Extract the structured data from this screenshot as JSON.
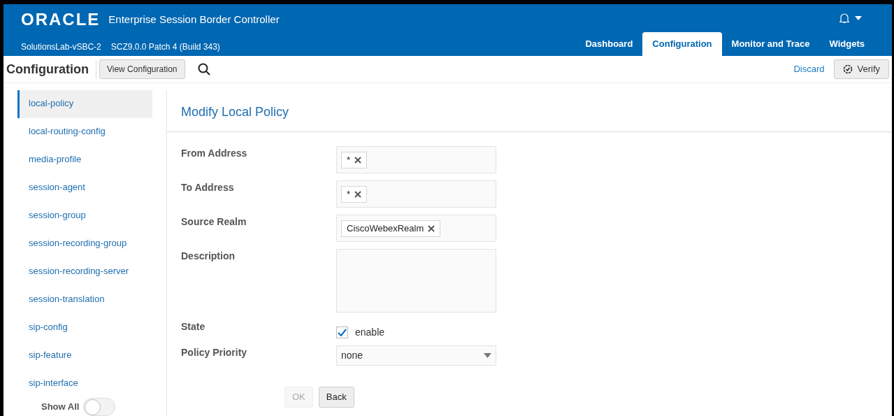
{
  "header": {
    "logo": "ORACLE",
    "product": "Enterprise Session Border Controller",
    "device": "SolutionsLab-vSBC-2",
    "version": "SCZ9.0.0 Patch 4 (Build 343)"
  },
  "tabs": [
    {
      "label": "Dashboard",
      "selected": false
    },
    {
      "label": "Configuration",
      "selected": true
    },
    {
      "label": "Monitor and Trace",
      "selected": false
    },
    {
      "label": "Widgets",
      "selected": false
    }
  ],
  "toolbar": {
    "title": "Configuration",
    "view_button": "View Configuration",
    "discard": "Discard",
    "verify": "Verify"
  },
  "sidebar": {
    "items": [
      {
        "label": "local-policy",
        "selected": true
      },
      {
        "label": "local-routing-config",
        "selected": false
      },
      {
        "label": "media-profile",
        "selected": false
      },
      {
        "label": "session-agent",
        "selected": false
      },
      {
        "label": "session-group",
        "selected": false
      },
      {
        "label": "session-recording-group",
        "selected": false
      },
      {
        "label": "session-recording-server",
        "selected": false
      },
      {
        "label": "session-translation",
        "selected": false
      },
      {
        "label": "sip-config",
        "selected": false
      },
      {
        "label": "sip-feature",
        "selected": false
      },
      {
        "label": "sip-interface",
        "selected": false
      }
    ],
    "show_all": {
      "label": "Show All",
      "on": false
    }
  },
  "form": {
    "title": "Modify Local Policy",
    "fields": [
      {
        "kind": "tags",
        "label": "From Address",
        "tags": [
          "*"
        ]
      },
      {
        "kind": "tags",
        "label": "To Address",
        "tags": [
          "*"
        ]
      },
      {
        "kind": "tags",
        "label": "Source Realm",
        "tags": [
          "CiscoWebexRealm"
        ]
      },
      {
        "kind": "textarea",
        "label": "Description"
      },
      {
        "kind": "checkbox",
        "label": "State",
        "option": "enable",
        "checked": true
      },
      {
        "kind": "select",
        "label": "Policy Priority",
        "value": "none"
      }
    ],
    "buttons": [
      {
        "label": "OK",
        "disabled": true
      },
      {
        "label": "Back",
        "disabled": false
      }
    ]
  }
}
